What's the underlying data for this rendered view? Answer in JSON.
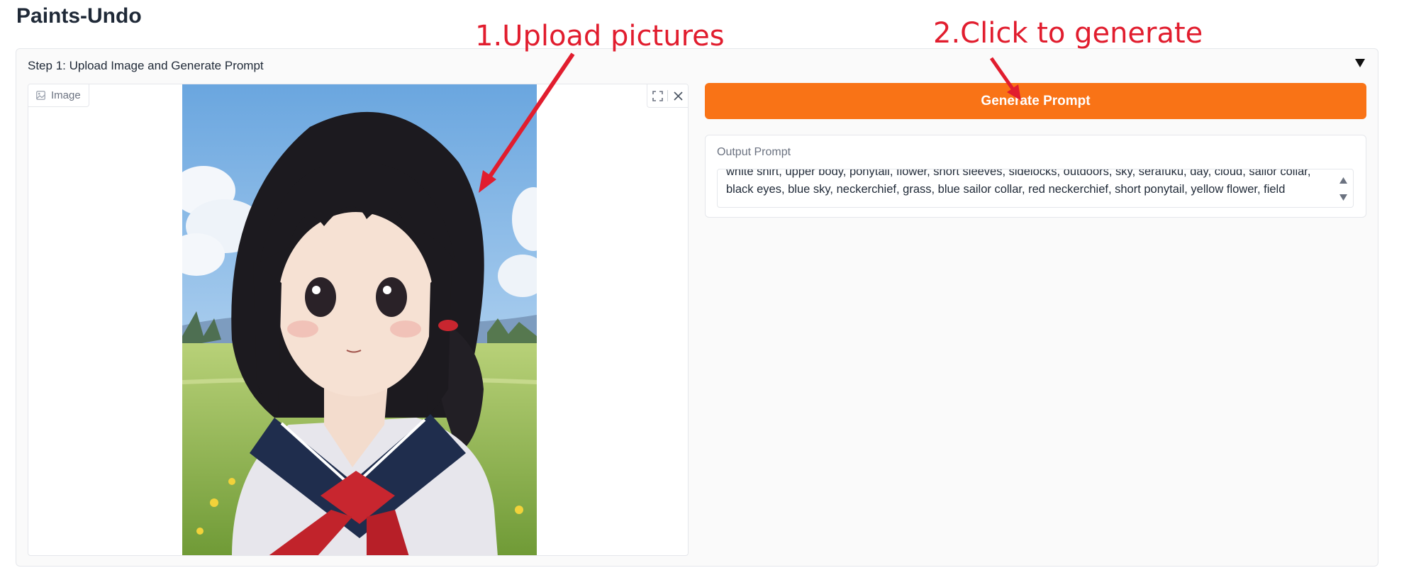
{
  "app": {
    "title": "Paints-Undo"
  },
  "step1": {
    "header": "Step 1: Upload Image and Generate Prompt",
    "image_label": "Image",
    "generate_button": "Generate Prompt",
    "output_label": "Output Prompt",
    "output_value": "white shirt, upper body, ponytail, flower, short sleeves, sidelocks, outdoors, sky, serafuku, day, cloud, sailor collar, black eyes, blue sky, neckerchief, grass, blue sailor collar, red neckerchief, short ponytail, yellow flower, field"
  },
  "annotations": {
    "upload": "1.Upload pictures",
    "generate": "2.Click to generate"
  },
  "colors": {
    "accent": "#f97316",
    "annotation": "#e11d2e",
    "sky": "#7fb4e6",
    "grass": "#9cc251"
  },
  "icons": {
    "collapse": "triangle-down-icon",
    "image_label": "image-icon",
    "fullscreen": "fullscreen-icon",
    "close": "close-icon",
    "scroll_up": "triangle-up-icon",
    "scroll_down": "triangle-down-icon"
  }
}
